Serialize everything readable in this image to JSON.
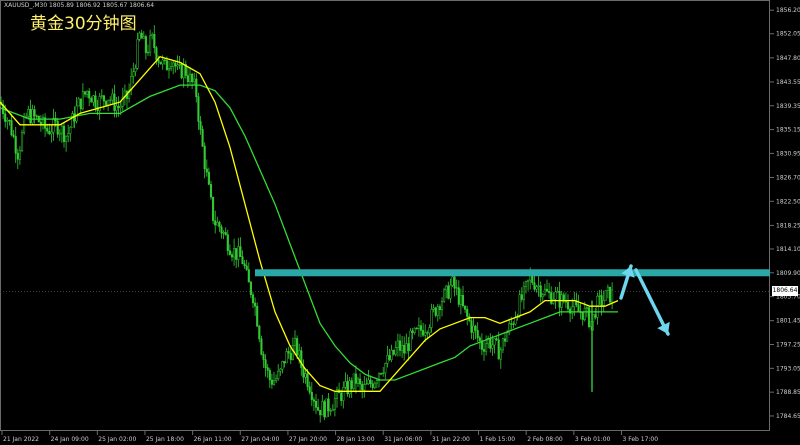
{
  "header": {
    "symbol_line": "XAUUSD_,M30  1805.89 1806.92 1805.67 1806.64",
    "chart_title": "黄金30分钟图"
  },
  "colors": {
    "background": "#000000",
    "candle": "#33cc33",
    "ma_fast": "#ffff00",
    "ma_slow": "#33dd33",
    "resistance": "#2aa7a7",
    "arrow": "#6fd6ef",
    "axis_text": "#cfcfcf",
    "frame": "#6b6b6b"
  },
  "chart_data": {
    "type": "candlestick",
    "symbol": "XAUUSD_,M30",
    "ohlc_last": {
      "open": 1805.89,
      "high": 1806.92,
      "low": 1805.67,
      "close": 1806.64
    },
    "current_price": 1806.64,
    "resistance_level": 1809.9,
    "ylim": [
      1782.0,
      1858.0
    ],
    "y_ticks": [
      "1856.20",
      "1852.05",
      "1847.80",
      "1843.55",
      "1839.35",
      "1835.15",
      "1830.95",
      "1826.70",
      "1822.50",
      "1818.25",
      "1814.10",
      "1809.90",
      "1805.70",
      "1801.45",
      "1797.25",
      "1793.05",
      "1788.85",
      "1784.65"
    ],
    "x_ticks": [
      "21 Jan 2022",
      "24 Jan 09:00",
      "25 Jan 02:00",
      "25 Jan 18:00",
      "26 Jan 11:00",
      "27 Jan 04:00",
      "27 Jan 20:00",
      "28 Jan 13:00",
      "31 Jan 06:00",
      "31 Jan 22:00",
      "1 Feb 15:00",
      "2 Feb 08:00",
      "3 Feb 01:00",
      "3 Feb 17:00"
    ],
    "price_path": [
      [
        0,
        1840
      ],
      [
        10,
        1836
      ],
      [
        18,
        1831
      ],
      [
        27,
        1838
      ],
      [
        37,
        1837
      ],
      [
        47,
        1835
      ],
      [
        57,
        1836
      ],
      [
        67,
        1834
      ],
      [
        77,
        1839
      ],
      [
        87,
        1842
      ],
      [
        97,
        1840
      ],
      [
        108,
        1841
      ],
      [
        118,
        1839
      ],
      [
        128,
        1841
      ],
      [
        135,
        1847
      ],
      [
        140,
        1852
      ],
      [
        146,
        1849
      ],
      [
        152,
        1851
      ],
      [
        158,
        1848
      ],
      [
        165,
        1846
      ],
      [
        172,
        1848
      ],
      [
        178,
        1845
      ],
      [
        184,
        1846
      ],
      [
        190,
        1844
      ],
      [
        196,
        1842
      ],
      [
        200,
        1835
      ],
      [
        205,
        1829
      ],
      [
        210,
        1823
      ],
      [
        214,
        1819
      ],
      [
        220,
        1818
      ],
      [
        226,
        1816
      ],
      [
        232,
        1814
      ],
      [
        238,
        1813
      ],
      [
        243,
        1812
      ],
      [
        248,
        1808
      ],
      [
        253,
        1806
      ],
      [
        258,
        1801
      ],
      [
        262,
        1796
      ],
      [
        266,
        1793
      ],
      [
        270,
        1791
      ],
      [
        275,
        1791
      ],
      [
        280,
        1792
      ],
      [
        285,
        1795
      ],
      [
        290,
        1796
      ],
      [
        296,
        1797
      ],
      [
        302,
        1793
      ],
      [
        308,
        1791
      ],
      [
        314,
        1788
      ],
      [
        318,
        1786
      ],
      [
        322,
        1786
      ],
      [
        326,
        1786
      ],
      [
        332,
        1787
      ],
      [
        338,
        1788
      ],
      [
        344,
        1789
      ],
      [
        350,
        1790
      ],
      [
        356,
        1791
      ],
      [
        362,
        1789
      ],
      [
        368,
        1790
      ],
      [
        374,
        1791
      ],
      [
        380,
        1793
      ],
      [
        386,
        1794
      ],
      [
        392,
        1795
      ],
      [
        398,
        1797
      ],
      [
        404,
        1796
      ],
      [
        410,
        1798
      ],
      [
        416,
        1799
      ],
      [
        422,
        1800
      ],
      [
        428,
        1801
      ],
      [
        434,
        1803
      ],
      [
        440,
        1805
      ],
      [
        446,
        1806
      ],
      [
        452,
        1808
      ],
      [
        458,
        1806
      ],
      [
        464,
        1803
      ],
      [
        470,
        1801
      ],
      [
        476,
        1799
      ],
      [
        482,
        1797
      ],
      [
        488,
        1798
      ],
      [
        494,
        1797
      ],
      [
        500,
        1796
      ],
      [
        506,
        1799
      ],
      [
        512,
        1801
      ],
      [
        518,
        1804
      ],
      [
        524,
        1806
      ],
      [
        530,
        1809
      ],
      [
        536,
        1808
      ],
      [
        542,
        1807
      ],
      [
        548,
        1806
      ],
      [
        554,
        1806
      ],
      [
        560,
        1805
      ],
      [
        566,
        1805
      ],
      [
        572,
        1804
      ],
      [
        578,
        1803
      ],
      [
        584,
        1803
      ],
      [
        588,
        1802
      ],
      [
        592,
        1801
      ],
      [
        596,
        1804
      ],
      [
        602,
        1805
      ],
      [
        608,
        1806
      ],
      [
        614,
        1806
      ]
    ],
    "spike_low": 1788.9,
    "ma_fast_path": [
      [
        0,
        1840
      ],
      [
        20,
        1836
      ],
      [
        40,
        1836
      ],
      [
        60,
        1836
      ],
      [
        80,
        1838
      ],
      [
        100,
        1839
      ],
      [
        120,
        1840
      ],
      [
        140,
        1844
      ],
      [
        160,
        1848
      ],
      [
        180,
        1847
      ],
      [
        200,
        1845
      ],
      [
        215,
        1840
      ],
      [
        230,
        1832
      ],
      [
        245,
        1822
      ],
      [
        260,
        1812
      ],
      [
        275,
        1803
      ],
      [
        290,
        1797
      ],
      [
        305,
        1793
      ],
      [
        320,
        1790
      ],
      [
        335,
        1789
      ],
      [
        350,
        1789
      ],
      [
        365,
        1789
      ],
      [
        380,
        1789
      ],
      [
        395,
        1792
      ],
      [
        410,
        1795
      ],
      [
        425,
        1798
      ],
      [
        440,
        1800
      ],
      [
        455,
        1801
      ],
      [
        470,
        1802
      ],
      [
        485,
        1802
      ],
      [
        500,
        1801
      ],
      [
        515,
        1802
      ],
      [
        530,
        1803
      ],
      [
        545,
        1805
      ],
      [
        560,
        1805
      ],
      [
        575,
        1805
      ],
      [
        590,
        1804
      ],
      [
        605,
        1804
      ],
      [
        618,
        1805
      ]
    ],
    "ma_slow_path": [
      [
        0,
        1839
      ],
      [
        30,
        1837
      ],
      [
        60,
        1837
      ],
      [
        90,
        1838
      ],
      [
        120,
        1838
      ],
      [
        150,
        1841
      ],
      [
        180,
        1843
      ],
      [
        200,
        1843
      ],
      [
        215,
        1842
      ],
      [
        230,
        1839
      ],
      [
        245,
        1834
      ],
      [
        260,
        1828
      ],
      [
        275,
        1822
      ],
      [
        290,
        1815
      ],
      [
        305,
        1808
      ],
      [
        320,
        1801
      ],
      [
        335,
        1797
      ],
      [
        350,
        1794
      ],
      [
        365,
        1792
      ],
      [
        380,
        1791
      ],
      [
        395,
        1791
      ],
      [
        410,
        1792
      ],
      [
        425,
        1793
      ],
      [
        440,
        1794
      ],
      [
        455,
        1795
      ],
      [
        470,
        1797
      ],
      [
        485,
        1798
      ],
      [
        500,
        1799
      ],
      [
        515,
        1800
      ],
      [
        530,
        1801
      ],
      [
        545,
        1802
      ],
      [
        560,
        1803
      ],
      [
        575,
        1803
      ],
      [
        590,
        1803
      ],
      [
        605,
        1803
      ],
      [
        618,
        1803
      ]
    ]
  }
}
